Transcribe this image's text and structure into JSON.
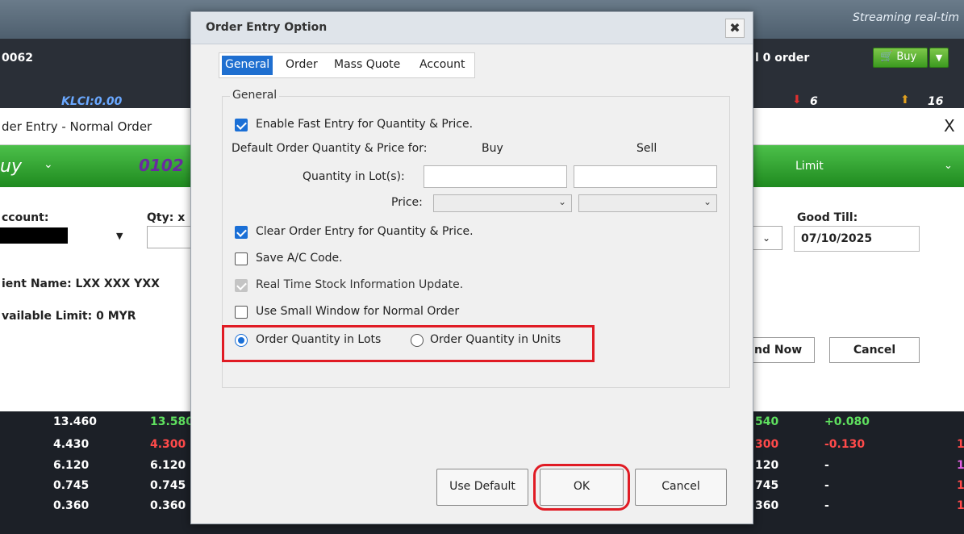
{
  "background_app": {
    "streaming_text": "Streaming real-tim",
    "stock_code": "0062",
    "order_count": "l 0 order",
    "buy_button": "Buy",
    "klci": "KLCI:0.00",
    "down_count": "6",
    "up_count": "16",
    "order_window_title": "der Entry - Normal Order",
    "order_window_close": "X",
    "side": "uy",
    "stock_number": "0102",
    "order_type": "Limit",
    "account_label": "ccount:",
    "qty_label": "Qty: x",
    "client_name": "ient Name:  LXX XXX YXX",
    "available_limit": "vailable Limit:   0 MYR",
    "good_till_label": "Good Till:",
    "good_till_value": "07/10/2025",
    "send_now": "nd Now",
    "cancel": "Cancel",
    "quote_rows": [
      {
        "c1": "13.460",
        "c2": "13.580",
        "c3": "540",
        "c4": "+0.080",
        "c5": ""
      },
      {
        "c1": "4.430",
        "c2": "4.300",
        "c3": "300",
        "c4": "-0.130",
        "c5": "1"
      },
      {
        "c1": "6.120",
        "c2": "6.120",
        "c3": "120",
        "c4": "-",
        "c5": "1"
      },
      {
        "c1": "0.745",
        "c2": "0.745",
        "c3": "745",
        "c4": "-",
        "c5": "1"
      },
      {
        "c1": "0.360",
        "c2": "0.360",
        "c3": "360",
        "c4": "-",
        "c5": "1"
      }
    ]
  },
  "dialog": {
    "title": "Order Entry Option",
    "close": "✖",
    "tabs": [
      "General",
      "Order",
      "Mass Quote",
      "Account"
    ],
    "group_title": "General",
    "enable_fast_entry": "Enable Fast Entry for Quantity & Price.",
    "default_qty_price_label": "Default Order Quantity & Price for:",
    "buy_header": "Buy",
    "sell_header": "Sell",
    "quantity_lots_label": "Quantity in Lot(s):",
    "price_label": "Price:",
    "clear_order_entry": "Clear Order Entry for Quantity & Price.",
    "save_ac_code": "Save A/C Code.",
    "real_time_update": "Real Time Stock Information Update.",
    "small_window": "Use Small Window for Normal Order",
    "radio_lots": "Order Quantity in Lots",
    "radio_units": "Order Quantity in Units",
    "btn_use_default": "Use Default",
    "btn_ok": "OK",
    "btn_cancel": "Cancel"
  },
  "colors": {
    "tab_active": "#1f6fd0",
    "highlight": "#e01b24",
    "buy_band": "#2a9a2a"
  }
}
